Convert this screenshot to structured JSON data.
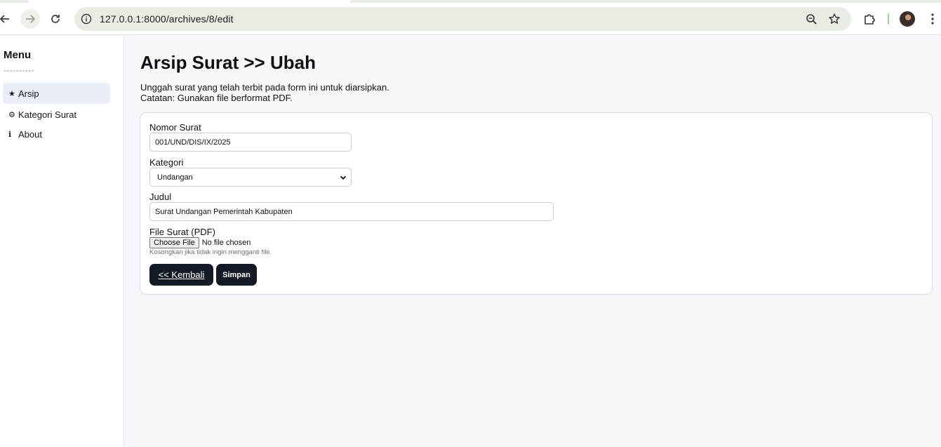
{
  "browser": {
    "url": "127.0.0.1:8000/archives/8/edit",
    "icons": [
      "back-arrow-icon",
      "forward-arrow-icon",
      "reload-icon",
      "site-info-icon",
      "zoom-icon",
      "bookmark-star-icon",
      "extensions-puzzle-icon",
      "profile-avatar",
      "more-vertical-icon"
    ]
  },
  "sidebar": {
    "title": "Menu",
    "divider": "----------",
    "items": [
      {
        "icon": "★",
        "label": "Arsip",
        "active": true
      },
      {
        "icon": "⚙",
        "label": "Kategori Surat",
        "active": false
      },
      {
        "icon": "ℹ",
        "label": "About",
        "active": false
      }
    ]
  },
  "main": {
    "title": "Arsip Surat >> Ubah",
    "description_line1": "Unggah surat yang telah terbit pada form ini untuk diarsipkan.",
    "description_line2": "Catatan: Gunakan file berformat PDF."
  },
  "form": {
    "nomor_label": "Nomor Surat",
    "nomor_value": "001/UND/DIS/IX/2025",
    "kategori_label": "Kategori",
    "kategori_value": "Undangan",
    "judul_label": "Judul",
    "judul_value": "Surat Undangan Pemerintah Kabupaten",
    "file_label": "File Surat (PDF)",
    "file_button": "Choose File",
    "file_status": "No file chosen",
    "file_hint": "Kosongkan jika tidak ingin mengganti file.",
    "back_button": "<< Kembali",
    "save_button": "Simpan"
  },
  "colors": {
    "button_bg": "#141a25",
    "active_menu_bg": "#eaeef9",
    "page_bg": "#f6f7fb"
  }
}
